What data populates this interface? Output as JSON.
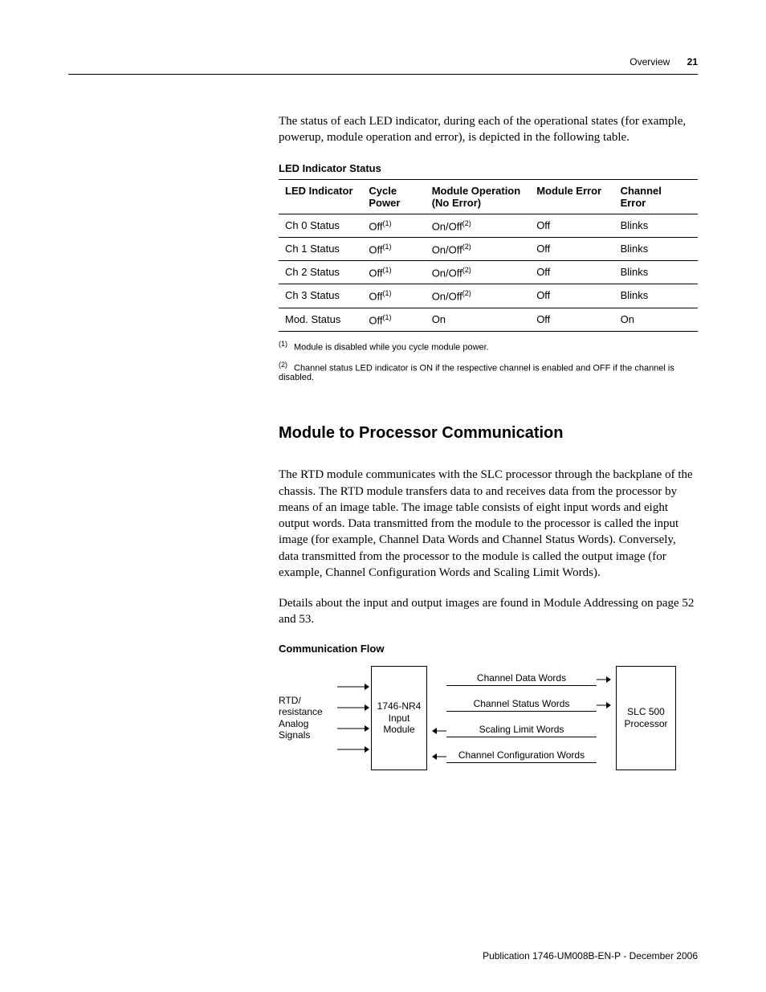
{
  "header": {
    "section": "Overview",
    "pagenum": "21"
  },
  "intro": "The status of each LED indicator, during each of the operational states (for example, powerup, module operation and error), is depicted in the following table.",
  "tableTitle": "LED Indicator Status",
  "columns": {
    "c1": "LED Indicator",
    "c2a": "Cycle",
    "c2b": "Power",
    "c3a": "Module Operation",
    "c3b": "(No Error)",
    "c4": "Module Error",
    "c5a": "Channel",
    "c5b": "Error"
  },
  "rows": [
    {
      "c1": "Ch 0 Status",
      "c2": "Off",
      "c2sup": "(1)",
      "c3": "On/Off",
      "c3sup": "(2)",
      "c4": "Off",
      "c5": "Blinks"
    },
    {
      "c1": "Ch 1 Status",
      "c2": "Off",
      "c2sup": "(1)",
      "c3": "On/Off",
      "c3sup": "(2)",
      "c4": "Off",
      "c5": "Blinks"
    },
    {
      "c1": "Ch 2 Status",
      "c2": "Off",
      "c2sup": "(1)",
      "c3": "On/Off",
      "c3sup": "(2)",
      "c4": "Off",
      "c5": "Blinks"
    },
    {
      "c1": "Ch 3 Status",
      "c2": "Off",
      "c2sup": "(1)",
      "c3": "On/Off",
      "c3sup": "(2)",
      "c4": "Off",
      "c5": "Blinks"
    },
    {
      "c1": "Mod. Status",
      "c2": "Off",
      "c2sup": "(1)",
      "c3": "On",
      "c3sup": "",
      "c4": "Off",
      "c5": "On"
    }
  ],
  "footnotes": {
    "f1sup": "(1)",
    "f1": "Module is disabled while you cycle module power.",
    "f2sup": "(2)",
    "f2": "Channel status LED indicator is ON if the respective channel is enabled and OFF if the channel is disabled."
  },
  "subhead": "Module to Processor Communication",
  "para1": "The RTD module communicates with the SLC processor through the backplane of the chassis. The RTD module transfers data to and receives data from the processor by means of an image table. The image table consists of eight input words and eight output words. Data transmitted from the module to the processor is called the input image (for example, Channel Data Words and Channel Status Words). Conversely, data transmitted from the processor to the module is called the output image (for example, Channel Configuration Words and Scaling Limit Words).",
  "para2": "Details about the input and output images are found in Module Addressing on page 52 and 53.",
  "diagramTitle": "Communication Flow",
  "diagram": {
    "left": "RTD/\nresistance\nAnalog\nSignals",
    "box1": "1746-NR4\nInput\nModule",
    "rows": [
      {
        "label": "Channel Data Words",
        "dir": "r"
      },
      {
        "label": "Channel Status Words",
        "dir": "r"
      },
      {
        "label": "Scaling Limit Words",
        "dir": "l"
      },
      {
        "label": "Channel Configuration Words",
        "dir": "l"
      }
    ],
    "box2": "SLC 500\nProcessor"
  },
  "footer": "Publication 1746-UM008B-EN-P - December 2006"
}
